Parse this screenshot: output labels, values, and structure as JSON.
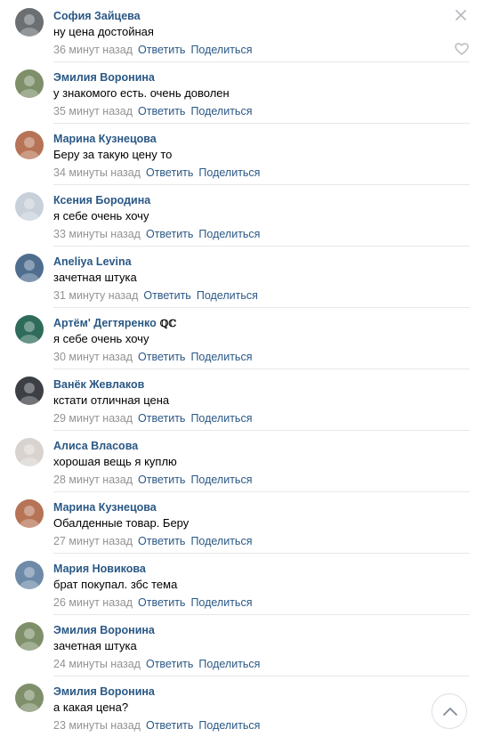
{
  "actions": {
    "reply_label": "Ответить",
    "share_label": "Поделиться"
  },
  "colors": {
    "link": "#2a5885",
    "meta": "#939393",
    "divider": "#e7e8ec"
  },
  "icons": {
    "close": "close-icon",
    "like": "heart-icon",
    "scroll_up": "chevron-up-icon"
  },
  "comments": [
    {
      "author": "София Зайцева",
      "badge": "",
      "text": "ну цена достойная",
      "time": "36 минут назад",
      "avatar_color": "#6b6f72"
    },
    {
      "author": "Эмилия Воронина",
      "badge": "",
      "text": "у знакомого есть. очень доволен",
      "time": "35 минут назад",
      "avatar_color": "#7f8f6a"
    },
    {
      "author": "Марина Кузнецова",
      "badge": "",
      "text": "Беру за такую цену то",
      "time": "34 минуты назад",
      "avatar_color": "#b67355"
    },
    {
      "author": "Ксения Бородина",
      "badge": "",
      "text": "я себе очень хочу",
      "time": "33 минуты назад",
      "avatar_color": "#c8d0da"
    },
    {
      "author": "Aneliya Levina",
      "badge": "",
      "text": "зачетная штука",
      "time": "31 минуту назад",
      "avatar_color": "#4f6e8f"
    },
    {
      "author": "Артём' Дегтяренко",
      "badge": "ℚℂ",
      "text": "я себе очень хочу",
      "time": "30 минут назад",
      "avatar_color": "#2f6b5a"
    },
    {
      "author": "Ванёк Жевлаков",
      "badge": "",
      "text": "кстати отличная цена",
      "time": "29 минут назад",
      "avatar_color": "#3c3f44"
    },
    {
      "author": "Алиса Власова",
      "badge": "",
      "text": "хорошая вещь я куплю",
      "time": "28 минут назад",
      "avatar_color": "#d9d3cf"
    },
    {
      "author": "Марина Кузнецова",
      "badge": "",
      "text": "Обалденные товар. Беру",
      "time": "27 минут назад",
      "avatar_color": "#b67355"
    },
    {
      "author": "Мария Новикова",
      "badge": "",
      "text": "брат покупал. збс тема",
      "time": "26 минут назад",
      "avatar_color": "#6d8aa8"
    },
    {
      "author": "Эмилия Воронина",
      "badge": "",
      "text": "зачетная штука",
      "time": "24 минуты назад",
      "avatar_color": "#7f8f6a"
    },
    {
      "author": "Эмилия Воронина",
      "badge": "",
      "text": "а какая цена?",
      "time": "23 минуты назад",
      "avatar_color": "#7f8f6a"
    }
  ]
}
